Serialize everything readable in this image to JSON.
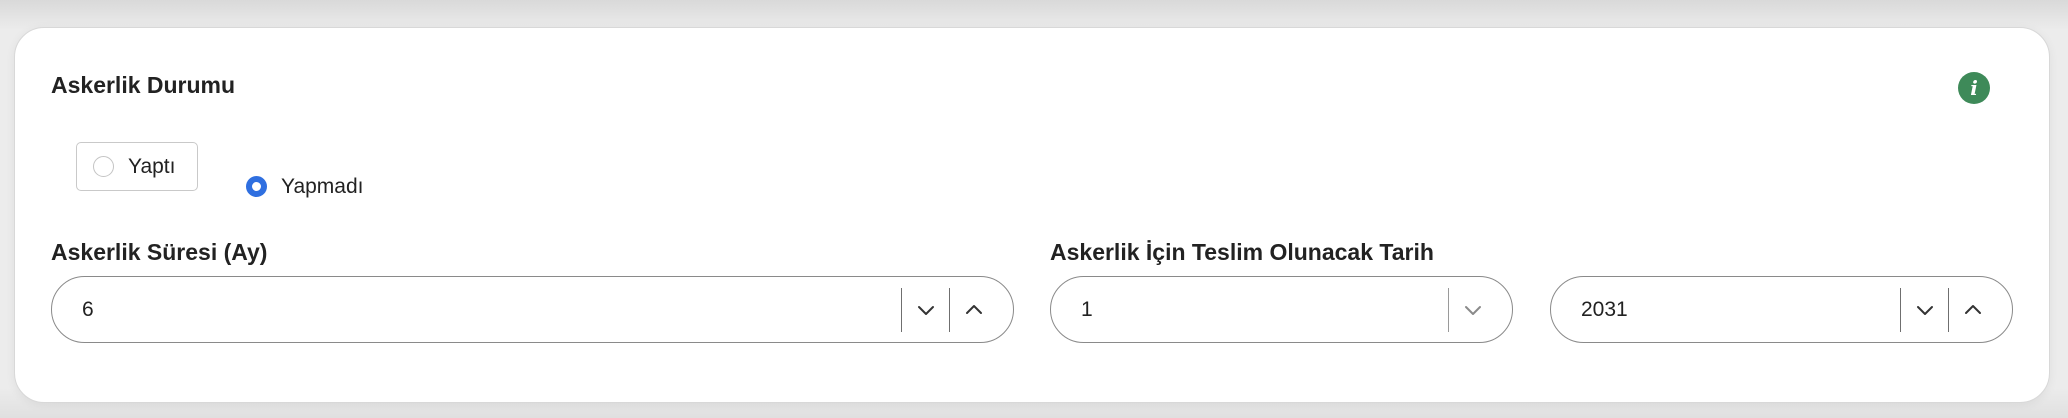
{
  "section": {
    "title": "Askerlik Durumu",
    "info_icon": "info-icon"
  },
  "military_status": {
    "options": [
      {
        "label": "Yaptı",
        "selected": false
      },
      {
        "label": "Yapmadı",
        "selected": true
      }
    ]
  },
  "duration": {
    "label": "Askerlik Süresi (Ay)",
    "value": "6",
    "down_icon": "chevron-down-icon",
    "up_icon": "chevron-up-icon"
  },
  "delivery_date": {
    "label": "Askerlik İçin Teslim Olunacak Tarih",
    "month_value": "1",
    "year_value": "2031"
  },
  "colors": {
    "accent_blue": "#2f6fe0",
    "info_green": "#3e8a59",
    "border": "#8a8a8a"
  }
}
